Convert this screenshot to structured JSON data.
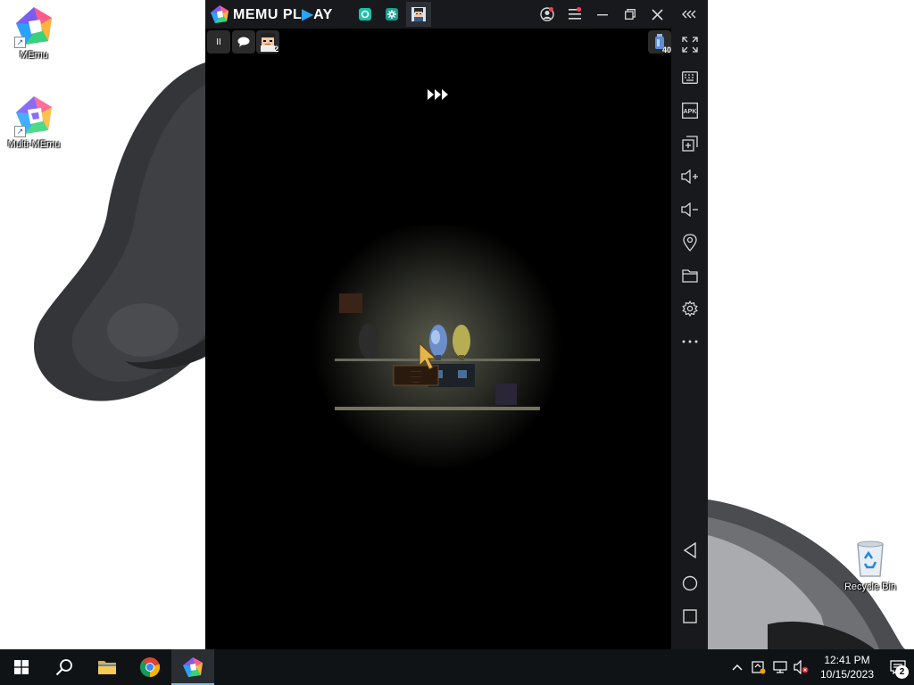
{
  "desktop": {
    "icons": [
      {
        "label": "MEmu"
      },
      {
        "label": "Multi-MEmu"
      },
      {
        "label": "Recycle Bin"
      }
    ]
  },
  "emulator": {
    "logo_text_a": "MEMU PL",
    "logo_text_b": "AY",
    "title_tabs": [
      "home-tab",
      "settings-tab",
      "game-tab"
    ],
    "overlay": {
      "pause_label": "II",
      "profile_badge": "2"
    },
    "storage_badge": "40",
    "game": {
      "sign_lines": [
        "...........",
        "..........",
        "........"
      ]
    },
    "sidebar_tools": [
      "fullscreen",
      "keyboard",
      "apk",
      "multi-window",
      "volume-up",
      "volume-down",
      "location",
      "folder",
      "settings",
      "more"
    ],
    "nav": [
      "back",
      "home",
      "recents"
    ]
  },
  "taskbar": {
    "apps": [
      "start",
      "search",
      "file-explorer",
      "chrome",
      "memu"
    ],
    "clock": {
      "time": "12:41 PM",
      "date": "10/15/2023"
    },
    "notification_count": "2"
  },
  "colors": {
    "accent": "#2aa3ff",
    "titlebar": "#17191c",
    "taskbar": "#101316",
    "badge": "#ff3a54"
  }
}
